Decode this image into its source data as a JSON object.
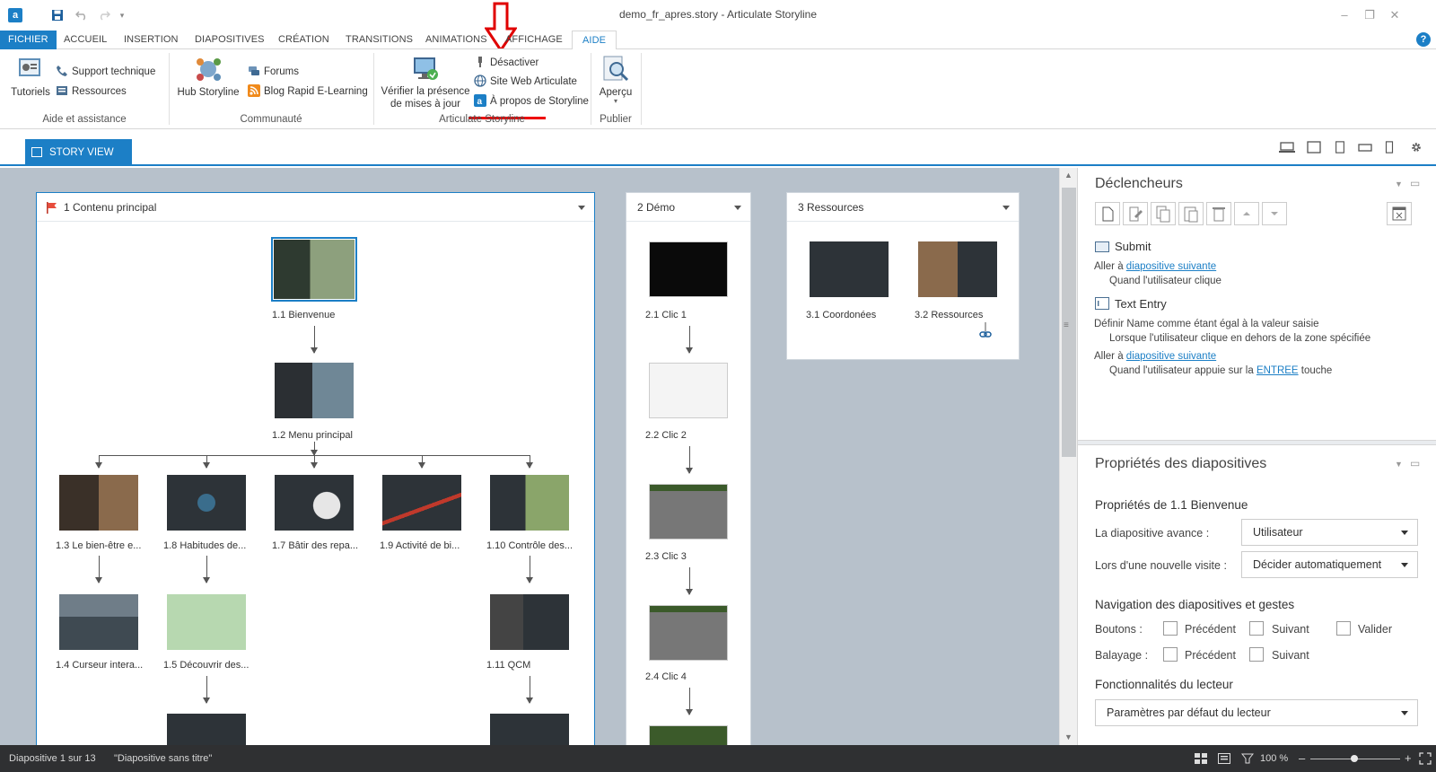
{
  "window": {
    "title": "demo_fr_apres.story - Articulate Storyline",
    "logo_letter": "a",
    "controls": [
      "–",
      "❐",
      "✕"
    ]
  },
  "ribbon_tabs": [
    "FICHIER",
    "ACCUEIL",
    "INSERTION",
    "DIAPOSITIVES",
    "CRÉATION",
    "TRANSITIONS",
    "ANIMATIONS",
    "AFFICHAGE",
    "AIDE"
  ],
  "help_icon": "?",
  "ribbon": {
    "group1": {
      "label": "Aide et assistance",
      "tutoriels": "Tutoriels",
      "support": "Support technique",
      "ressources": "Ressources"
    },
    "group2": {
      "label": "Communauté",
      "hub": "Hub Storyline",
      "forums": "Forums",
      "blog": "Blog Rapid E-Learning"
    },
    "group3": {
      "label": "Articulate Storyline",
      "verifier_line1": "Vérifier la présence",
      "verifier_line2": "de mises à jour",
      "desactiver": "Désactiver",
      "site": "Site Web Articulate",
      "apropos": "À propos de Storyline"
    },
    "group4": {
      "label": "Publier",
      "apercu": "Aperçu"
    }
  },
  "story_view": {
    "tab_label": "STORY VIEW"
  },
  "scenes": [
    {
      "title": "1 Contenu principal",
      "slides": [
        "1.1 Bienvenue",
        "1.2 Menu principal",
        "1.3 Le bien-être e...",
        "1.8 Habitudes de...",
        "1.7 Bâtir des repa...",
        "1.9 Activité de bi...",
        "1.10 Contrôle des...",
        "1.4 Curseur intera...",
        "1.5 Découvrir des...",
        "1.11 QCM"
      ]
    },
    {
      "title": "2 Démo",
      "slides": [
        "2.1 Clic 1",
        "2.2 Clic 2",
        "2.3 Clic 3",
        "2.4 Clic 4"
      ]
    },
    {
      "title": "3 Ressources",
      "slides": [
        "3.1 Coordonées",
        "3.2 Ressources"
      ]
    }
  ],
  "triggers": {
    "title": "Déclencheurs",
    "obj1": "Submit",
    "t1_prefix": "Aller à ",
    "t1_link": "diapositive suivante",
    "t1_when": "Quand l'utilisateur clique",
    "obj2": "Text Entry",
    "t2": "Définir Name comme étant égal à la valeur saisie",
    "t2_when": "Lorsque l'utilisateur clique en dehors de la zone spécifiée",
    "t3_prefix": "Aller à ",
    "t3_link": "diapositive suivante",
    "t3_when_prefix": "Quand l'utilisateur appuie sur la ",
    "t3_when_link": "ENTREE",
    "t3_when_suffix": " touche"
  },
  "properties": {
    "title": "Propriétés des diapositives",
    "heading": "Propriétés de 1.1 Bienvenue",
    "avance_label": "La diapositive avance :",
    "avance_value": "Utilisateur",
    "visite_label": "Lors d'une nouvelle visite :",
    "visite_value": "Décider automatiquement",
    "nav_heading": "Navigation des diapositives et gestes",
    "boutons_label": "Boutons :",
    "precedent": "Précédent",
    "suivant": "Suivant",
    "valider": "Valider",
    "balayage_label": "Balayage :",
    "lecteur_heading": "Fonctionnalités du lecteur",
    "lecteur_value": "Paramètres par défaut du lecteur"
  },
  "status": {
    "slide_count": "Diapositive 1 sur 13",
    "slide_title": "\"Diapositive sans titre\"",
    "zoom": "100 %",
    "minus": "–",
    "plus": "+"
  },
  "accent_color": "#1c7fc6",
  "annotation_color": "#e00000"
}
